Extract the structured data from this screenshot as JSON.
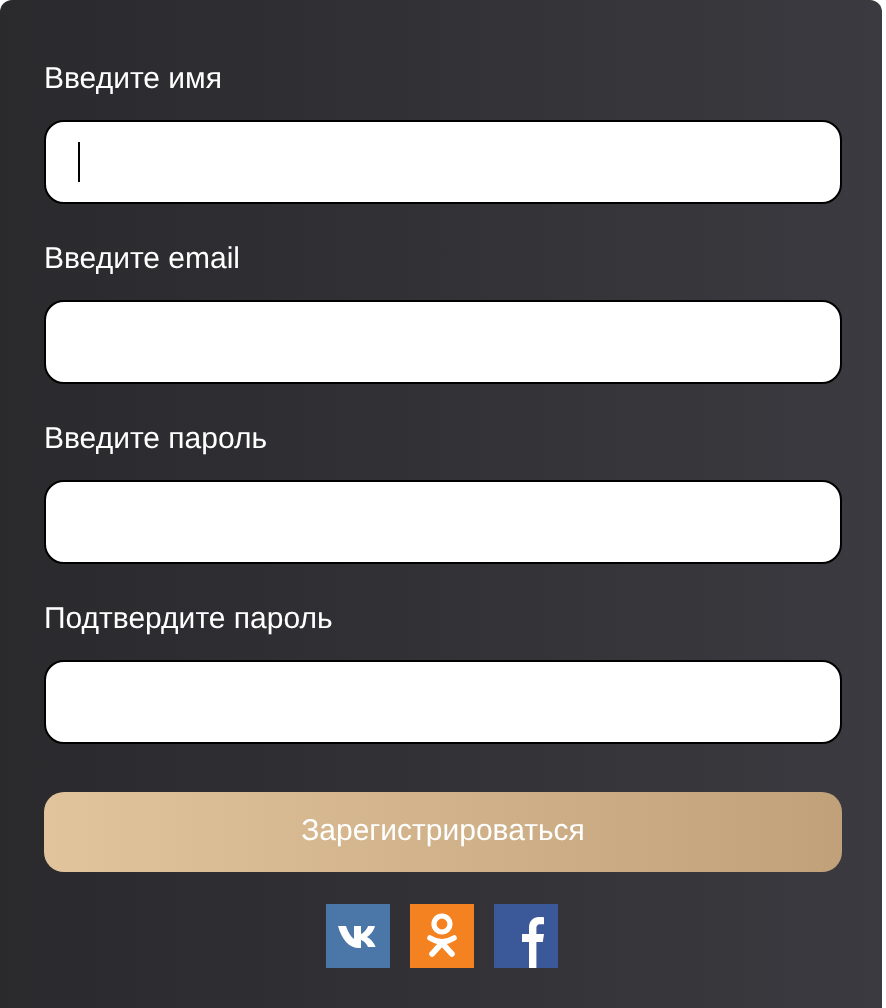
{
  "fields": [
    {
      "label": "Введите имя",
      "focused": true
    },
    {
      "label": "Введите email",
      "focused": false
    },
    {
      "label": "Введите пароль",
      "focused": false
    },
    {
      "label": "Подтвердите пароль",
      "focused": false
    }
  ],
  "submit_button": {
    "label": "Зарегистрироваться"
  },
  "social_links": [
    {
      "kind": "vk"
    },
    {
      "kind": "ok"
    },
    {
      "kind": "facebook"
    }
  ]
}
